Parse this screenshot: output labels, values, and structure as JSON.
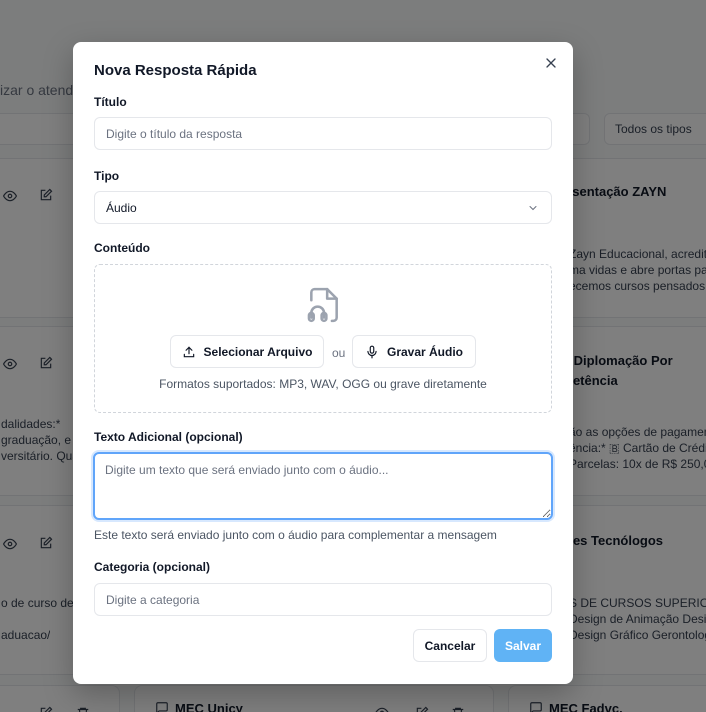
{
  "background": {
    "subtitle_fragment": "izar o atendi",
    "filter_types": "Todos os tipos",
    "cards": [
      {
        "title": "esentação ZAYN",
        "lines": [
          "Zayn Educacional, acredita",
          "ma vidas e abre portas par",
          "ecemos cursos pensados"
        ]
      },
      {
        "title_line1": "r Diplomação Por",
        "title_line2": "petência",
        "lines": [
          "ão as opções de pagamen",
          "ência:* 🇧 Cartão de Crédi",
          "Parcelas: 10x de R$ 250,00"
        ]
      },
      {
        "title": "ões Tecnólogos",
        "lines": [
          "S DE CURSOS SUPERIORES",
          "Design de Animação Desig",
          "Design Gráfico Gerontolog"
        ]
      },
      {
        "left_lines": [
          "dalidades:*",
          "graduação, e P",
          "versitário. Qua"
        ]
      },
      {
        "left_lines": [
          "o de curso de g",
          "aduacao/"
        ]
      },
      {
        "title": "MEC Unicy"
      },
      {
        "title": "MEC Fadvc."
      }
    ]
  },
  "modal": {
    "title": "Nova Resposta Rápida",
    "titulo_label": "Título",
    "titulo_placeholder": "Digite o título da resposta",
    "tipo_label": "Tipo",
    "tipo_value": "Áudio",
    "conteudo_label": "Conteúdo",
    "select_file_label": "Selecionar Arquivo",
    "or_text": "ou",
    "record_audio_label": "Gravar Áudio",
    "formats_text": "Formatos suportados: MP3, WAV, OGG ou grave diretamente",
    "texto_adicional_label": "Texto Adicional (opcional)",
    "texto_adicional_placeholder": "Digite um texto que será enviado junto com o áudio...",
    "texto_adicional_helper": "Este texto será enviado junto com o áudio para complementar a mensagem",
    "categoria_label": "Categoria (opcional)",
    "categoria_placeholder": "Digite a categoria",
    "cancel_label": "Cancelar",
    "save_label": "Salvar"
  },
  "colors": {
    "save_button": "#60b3f5",
    "focus_ring": "#60a5fa",
    "overlay": "rgba(0,0,0,0.5)"
  },
  "icons": [
    "close-icon",
    "chevron-down-icon",
    "file-audio-icon",
    "upload-icon",
    "microphone-icon",
    "eye-icon",
    "edit-icon",
    "message-square-icon",
    "trash-icon"
  ]
}
